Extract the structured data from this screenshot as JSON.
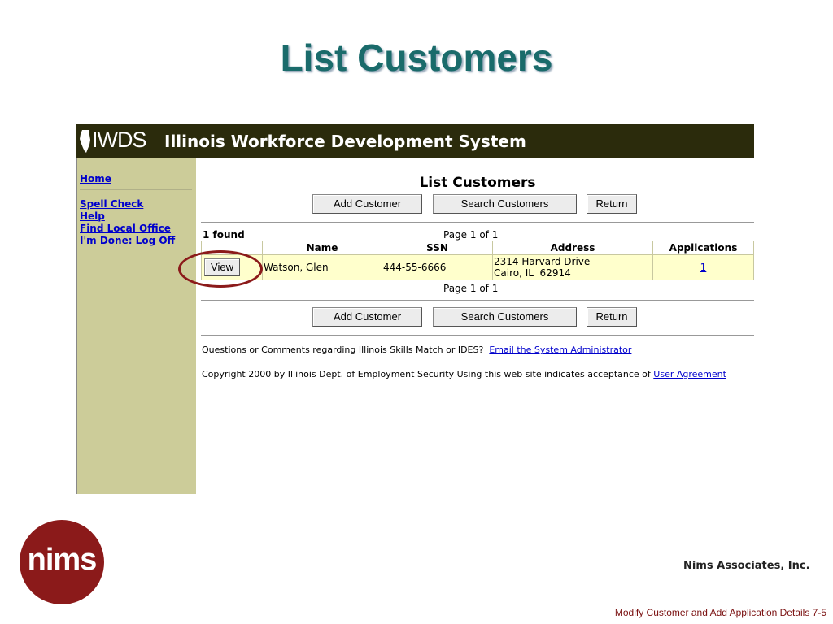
{
  "slide": {
    "title": "List Customers",
    "company": "Nims Associates, Inc.",
    "footer": "Modify Customer and Add Application Details 7-5",
    "logo_text": "nims"
  },
  "app": {
    "logo_text": "IWDS",
    "title": "Illinois Workforce Development System"
  },
  "sidebar": {
    "items": [
      {
        "label": "Home"
      },
      {
        "label": "Spell Check"
      },
      {
        "label": "Help"
      },
      {
        "label": "Find Local Office"
      },
      {
        "label": "I'm Done: Log Off"
      }
    ]
  },
  "main": {
    "heading": "List Customers",
    "buttons": {
      "add": "Add Customer",
      "search": "Search Customers",
      "return": "Return"
    },
    "found": "1  found",
    "pagination": "Page 1 of 1",
    "table": {
      "headers": [
        "",
        "Name",
        "SSN",
        "Address",
        "Applications"
      ],
      "rows": [
        {
          "action": "View",
          "name": "Watson, Glen",
          "ssn": "444-55-6666",
          "address_line1": "2314 Harvard Drive",
          "address_line2": "Cairo, IL  62914",
          "applications": "1"
        }
      ]
    },
    "questions_text": "Questions or Comments regarding Illinois Skills Match or IDES?",
    "email_link": "Email the System Administrator",
    "copyright_text": "Copyright 2000 by Illinois Dept. of Employment Security Using this web site indicates acceptance of",
    "agreement_link": "User Agreement"
  },
  "colors": {
    "title": "#1a6b6b",
    "header_bg": "#2b2b0c",
    "sidebar_bg": "#cccc99",
    "row_bg": "#ffffcc",
    "link": "#0000cc",
    "highlight": "#8b1a1a"
  }
}
